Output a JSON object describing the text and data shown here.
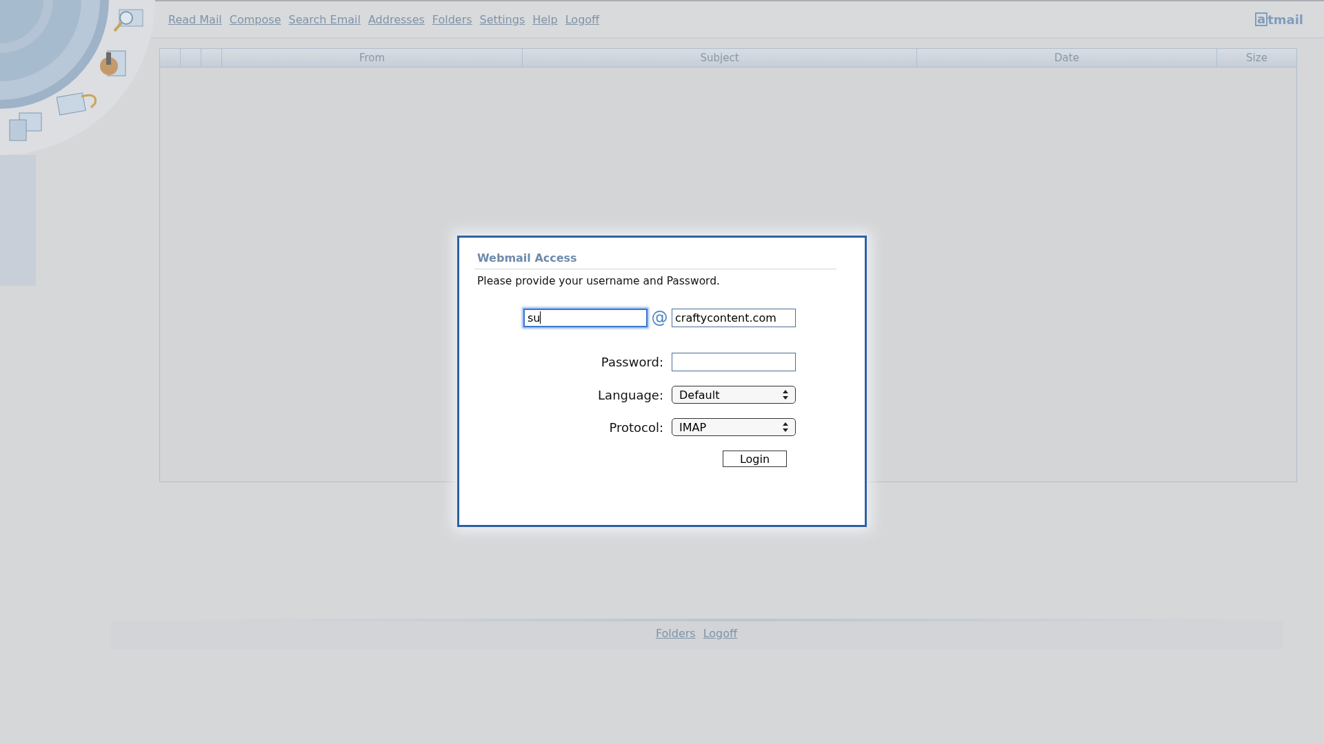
{
  "nav": {
    "links": [
      "Read Mail",
      "Compose",
      "Search Email",
      "Addresses",
      "Folders",
      "Settings",
      "Help",
      "Logoff"
    ]
  },
  "logo": {
    "mark": "a",
    "name": "tmail"
  },
  "table": {
    "columns": [
      {
        "kind": "blank"
      },
      {
        "kind": "blank"
      },
      {
        "kind": "blank"
      },
      {
        "kind": "text",
        "label": "From"
      },
      {
        "kind": "text",
        "label": "Subject"
      },
      {
        "kind": "text",
        "label": "Date"
      },
      {
        "kind": "text",
        "label": "Size"
      }
    ]
  },
  "dialog": {
    "title": "Webmail Access",
    "message": "Please provide your username and Password.",
    "username": {
      "value": "su",
      "focused": true
    },
    "at": "@",
    "domain": {
      "value": "craftycontent.com",
      "focused": false
    },
    "fields": [
      {
        "kind": "password",
        "label": "Password:"
      },
      {
        "kind": "select",
        "label": "Language:",
        "value": "Default"
      },
      {
        "kind": "select",
        "label": "Protocol:",
        "value": "IMAP"
      }
    ],
    "button": "Login"
  },
  "footer": {
    "links": [
      "Folders",
      "Logoff"
    ]
  }
}
